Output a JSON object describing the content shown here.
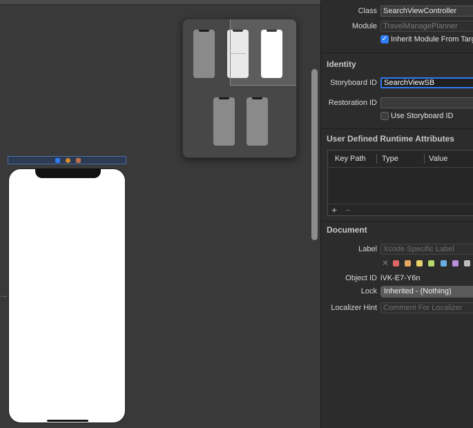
{
  "canvas": {
    "entry_arrow_icon": "arrow-right-icon",
    "scene_dock_icons": [
      "view-controller-icon",
      "first-responder-icon",
      "exit-icon"
    ]
  },
  "inspector": {
    "custom_class": {
      "class_label": "Class",
      "class_value": "SearchViewController",
      "module_label": "Module",
      "module_value": "TravelManagePlanner",
      "inherit_label": "Inherit Module From Target",
      "inherit_checked": true
    },
    "identity": {
      "title": "Identity",
      "storyboard_id_label": "Storyboard ID",
      "storyboard_id_value": "SearchViewSB",
      "restoration_id_label": "Restoration ID",
      "restoration_id_value": "",
      "use_storyboard_id_label": "Use Storyboard ID",
      "use_storyboard_id_checked": false
    },
    "runtime_attributes": {
      "title": "User Defined Runtime Attributes",
      "columns": [
        "Key Path",
        "Type",
        "Value"
      ],
      "add_label": "+",
      "remove_label": "−"
    },
    "document": {
      "title": "Document",
      "label_label": "Label",
      "label_placeholder": "Xcode Specific Label",
      "label_clear": "✕",
      "label_colors": [
        "#e06666",
        "#e6a860",
        "#e6d36a",
        "#b7d96a",
        "#6ab0e6",
        "#b98ee0",
        "#bdbdbd"
      ],
      "object_id_label": "Object ID",
      "object_id_value": "iVK-E7-Y6n",
      "lock_label": "Lock",
      "lock_value": "Inherited - (Nothing)",
      "localizer_label": "Localizer Hint",
      "localizer_placeholder": "Comment For Localizer"
    }
  },
  "colors": {
    "accent": "#2e7cf6",
    "canvas_bg": "#393939",
    "inspector_bg": "#2c2c2c"
  }
}
